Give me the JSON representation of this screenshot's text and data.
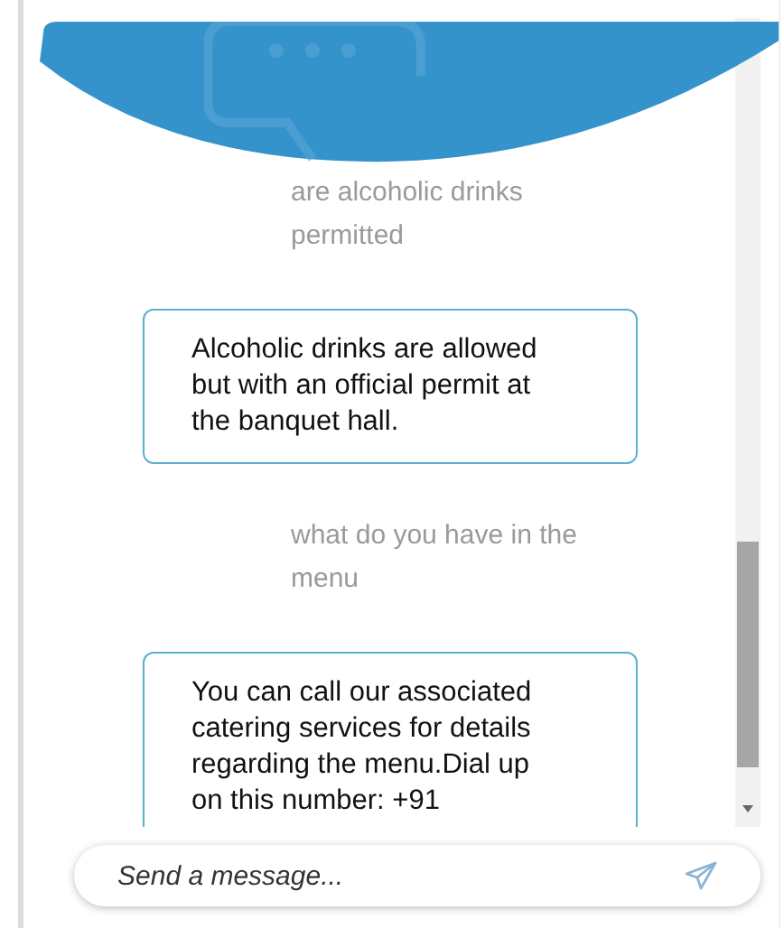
{
  "messages": [
    {
      "kind": "user",
      "text": "are alcoholic drinks permitted"
    },
    {
      "kind": "bot",
      "text": "Alcoholic drinks are allowed but with an official permit at the banquet hall."
    },
    {
      "kind": "user",
      "text": "what do you have in the menu"
    },
    {
      "kind": "bot",
      "text": "You can call our associated catering services for details regarding the menu.Dial up on this number: +91"
    }
  ],
  "composer": {
    "placeholder": "Send a message..."
  }
}
